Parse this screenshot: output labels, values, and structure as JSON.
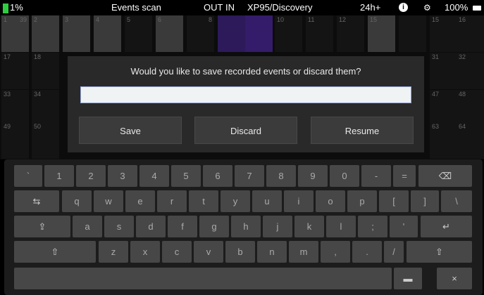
{
  "statusbar": {
    "battery_level_left": "1%",
    "title": "Events scan",
    "out_label": "OUT",
    "in_label": "IN",
    "device": "XP95/Discovery",
    "range": "24h+",
    "info_icon": "i",
    "gear_icon": "⚙",
    "battery_level_right": "100%"
  },
  "grid": {
    "row1": [
      "1",
      "2",
      "3",
      "4",
      "5",
      "6",
      "7",
      "8",
      "9",
      "10",
      "11",
      "12",
      "15",
      "16"
    ],
    "row1_sub": [
      "39",
      "2",
      "3",
      "4",
      "5",
      "6"
    ],
    "row2": [
      "17",
      "18",
      "31",
      "32"
    ],
    "row3": [
      "33",
      "34",
      "47",
      "48"
    ],
    "row4": [
      "49",
      "50",
      "63",
      "64"
    ]
  },
  "dialog": {
    "message": "Would you like to save recorded events or discard them?",
    "input_value": "",
    "save_label": "Save",
    "discard_label": "Discard",
    "resume_label": "Resume"
  },
  "keyboard": {
    "row1": [
      "`",
      "1",
      "2",
      "3",
      "4",
      "5",
      "6",
      "7",
      "8",
      "9",
      "0",
      "-",
      "=",
      "⌫"
    ],
    "row2": [
      "⇆",
      "q",
      "w",
      "e",
      "r",
      "t",
      "y",
      "u",
      "i",
      "o",
      "p",
      "[",
      "]",
      "\\"
    ],
    "row3": [
      "⇪",
      "a",
      "s",
      "d",
      "f",
      "g",
      "h",
      "j",
      "k",
      "l",
      ";",
      "'",
      "↵"
    ],
    "row4": [
      "⇧",
      "z",
      "x",
      "c",
      "v",
      "b",
      "n",
      "m",
      ",",
      ".",
      "/",
      "⇧"
    ],
    "row5": [
      "",
      "▬",
      "×"
    ]
  }
}
